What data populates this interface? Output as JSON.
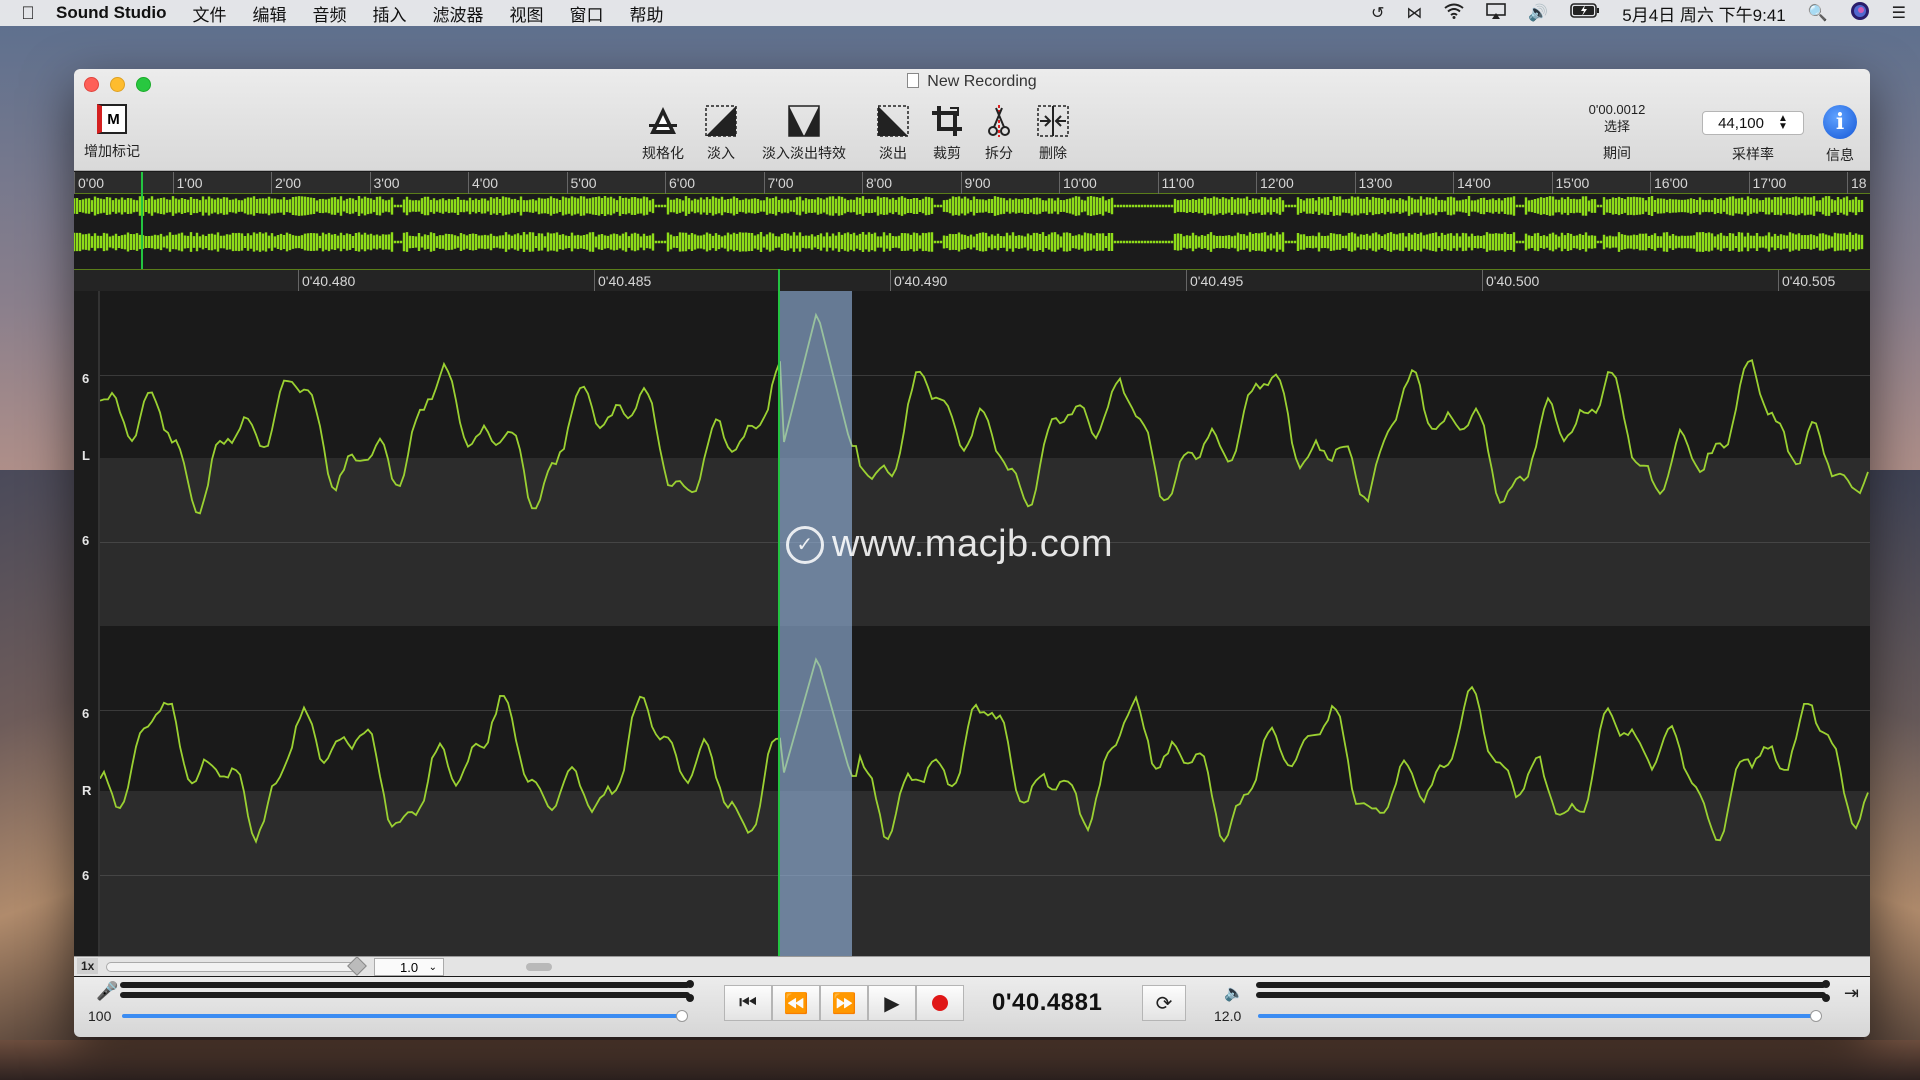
{
  "menubar": {
    "app_name": "Sound Studio",
    "items": [
      "文件",
      "编辑",
      "音频",
      "插入",
      "滤波器",
      "视图",
      "窗口",
      "帮助"
    ],
    "datetime": "5月4日 周六 下午9:41"
  },
  "window": {
    "title": "New Recording"
  },
  "toolbar": {
    "add_marker": "增加标记",
    "tools": [
      {
        "label": "规格化",
        "icon": "normalize-icon"
      },
      {
        "label": "淡入",
        "icon": "fade-in-icon"
      },
      {
        "label": "淡入淡出特效",
        "icon": "crossfade-icon"
      },
      {
        "label": "淡出",
        "icon": "fade-out-icon"
      },
      {
        "label": "裁剪",
        "icon": "crop-icon"
      },
      {
        "label": "拆分",
        "icon": "split-icon"
      },
      {
        "label": "删除",
        "icon": "delete-icon"
      }
    ],
    "selection_time": "0'00.0012",
    "selection_label": "选择",
    "duration_label": "期间",
    "sample_rate": "44,100",
    "sample_rate_label": "采样率",
    "info_label": "信息"
  },
  "overview": {
    "ticks": [
      "0'00",
      "1'00",
      "2'00",
      "3'00",
      "4'00",
      "5'00",
      "6'00",
      "7'00",
      "8'00",
      "9'00",
      "10'00",
      "11'00",
      "12'00",
      "13'00",
      "14'00",
      "15'00",
      "16'00",
      "17'00",
      "18"
    ],
    "waveform_color": "#8edc1a"
  },
  "detail_ruler": {
    "ticks": [
      "0'40.480",
      "0'40.485",
      "0'40.490",
      "0'40.495",
      "0'40.500",
      "0'40.505"
    ]
  },
  "channels": {
    "left_label": "L",
    "right_label": "R",
    "scale_label": "6",
    "wave_color": "#9bd132"
  },
  "watermark": "www.macjb.com",
  "zoom": {
    "label": "1x",
    "value": "1.0"
  },
  "transport": {
    "input_level": "100",
    "output_level": "12.0",
    "time": "0'40.4881"
  }
}
